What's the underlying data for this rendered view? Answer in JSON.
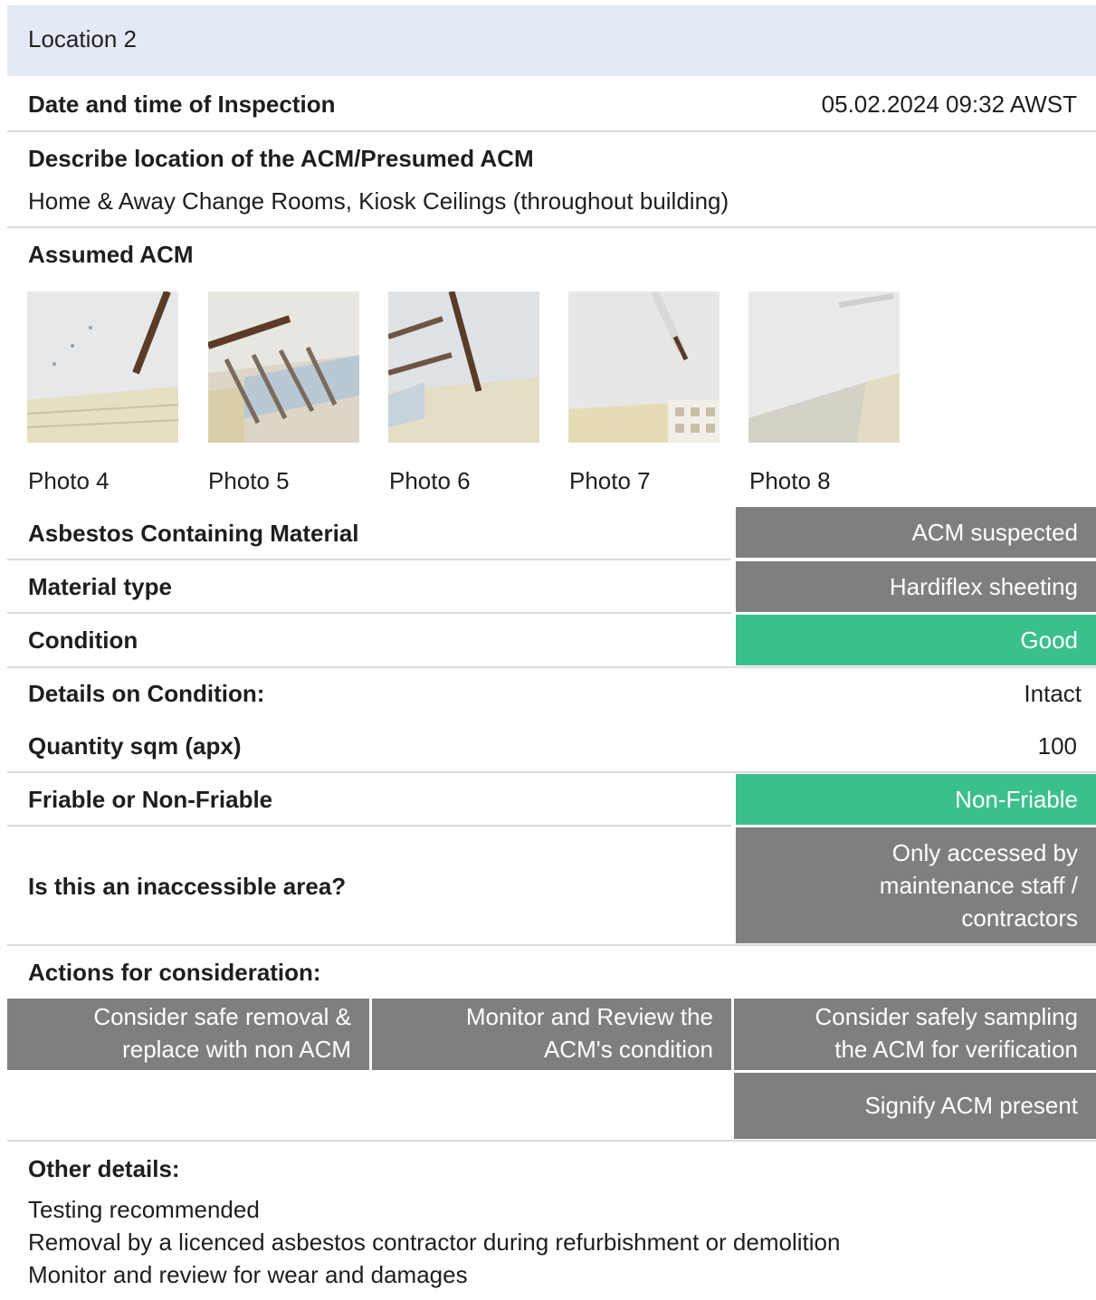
{
  "header": {
    "title": "Location 2"
  },
  "inspection": {
    "label": "Date and time of Inspection",
    "value": "05.02.2024 09:32 AWST"
  },
  "location": {
    "label": "Describe location of the ACM/Presumed ACM",
    "value": "Home & Away Change Rooms, Kiosk Ceilings (throughout building)"
  },
  "assumed": {
    "label": "Assumed ACM"
  },
  "photos": [
    {
      "caption": "Photo 4",
      "icon": "ceiling-photo"
    },
    {
      "caption": "Photo 5",
      "icon": "ceiling-photo"
    },
    {
      "caption": "Photo 6",
      "icon": "ceiling-photo"
    },
    {
      "caption": "Photo 7",
      "icon": "ceiling-photo"
    },
    {
      "caption": "Photo 8",
      "icon": "ceiling-photo"
    }
  ],
  "fields": {
    "acm": {
      "label": "Asbestos Containing Material",
      "value": "ACM suspected",
      "color": "#7f7f7f"
    },
    "material": {
      "label": "Material type",
      "value": "Hardiflex sheeting",
      "color": "#7f7f7f"
    },
    "condition": {
      "label": "Condition",
      "value": "Good",
      "color": "#3cc08b"
    },
    "details": {
      "label": "Details on Condition:",
      "value": "Intact"
    },
    "quantity": {
      "label": "Quantity sqm (apx)",
      "value": "100"
    },
    "friable": {
      "label": "Friable or Non-Friable",
      "value": "Non-Friable",
      "color": "#3cc08b"
    },
    "inaccessible": {
      "label": "Is this an inaccessible area?",
      "value_lines": [
        "Only accessed by",
        "maintenance staff /",
        "contractors"
      ],
      "color": "#7f7f7f"
    }
  },
  "actions": {
    "label": "Actions for consideration:",
    "items": [
      {
        "lines": [
          "Consider safe removal &",
          "replace with non ACM"
        ]
      },
      {
        "lines": [
          "Monitor and Review the",
          "ACM's condition"
        ]
      },
      {
        "lines": [
          "Consider safely sampling",
          "the ACM for verification"
        ]
      },
      {
        "lines": [
          "Signify ACM present"
        ]
      }
    ]
  },
  "other": {
    "label": "Other details:",
    "lines": [
      "Testing recommended",
      "Removal by a licenced asbestos contractor during refurbishment or demolition",
      "Monitor and review for wear and damages"
    ]
  }
}
